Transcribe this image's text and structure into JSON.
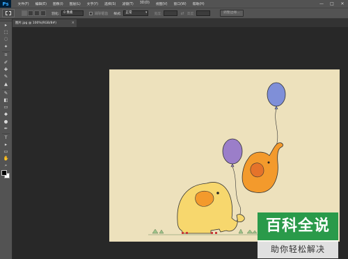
{
  "app": {
    "logo": "Ps"
  },
  "menu": [
    "文件(F)",
    "编辑(E)",
    "图像(I)",
    "图层(L)",
    "文字(Y)",
    "选择(S)",
    "滤镜(T)",
    "3D(D)",
    "视图(V)",
    "窗口(W)",
    "帮助(H)"
  ],
  "window_controls": {
    "minimize": "—",
    "maximize": "□",
    "close": "✕"
  },
  "options": {
    "feather_label": "羽化:",
    "feather_value": "0 像素",
    "antialias_label": "消除锯齿",
    "style_label": "样式:",
    "style_value": "正常",
    "width_label": "宽度:",
    "height_label": "高度:",
    "refine_edge": "调整边缘..."
  },
  "document": {
    "tab_title": "图片.jpg @ 100%(RGB/8#)",
    "tab_close": "×"
  },
  "tools": [
    "move-icon",
    "marquee-icon",
    "lasso-icon",
    "magic-wand-icon",
    "crop-icon",
    "eyedropper-icon",
    "healing-icon",
    "brush-icon",
    "stamp-icon",
    "history-brush-icon",
    "eraser-icon",
    "gradient-icon",
    "blur-icon",
    "dodge-icon",
    "pen-icon",
    "type-icon",
    "path-select-icon",
    "shape-icon",
    "hand-icon",
    "zoom-icon"
  ],
  "tool_glyphs": [
    "▸",
    "⬚",
    "◌",
    "✦",
    "⌗",
    "✐",
    "✚",
    "✎",
    "▲",
    "✎",
    "◧",
    "▭",
    "◆",
    "●",
    "✒",
    "T",
    "▸",
    "▭",
    "✋",
    "⌕"
  ],
  "colors": {
    "foreground": "#000000",
    "background": "#ffffff",
    "canvas_bg": "#ede1bc"
  },
  "watermark": {
    "title": "百科全说",
    "subtitle": "助你轻松解决"
  }
}
